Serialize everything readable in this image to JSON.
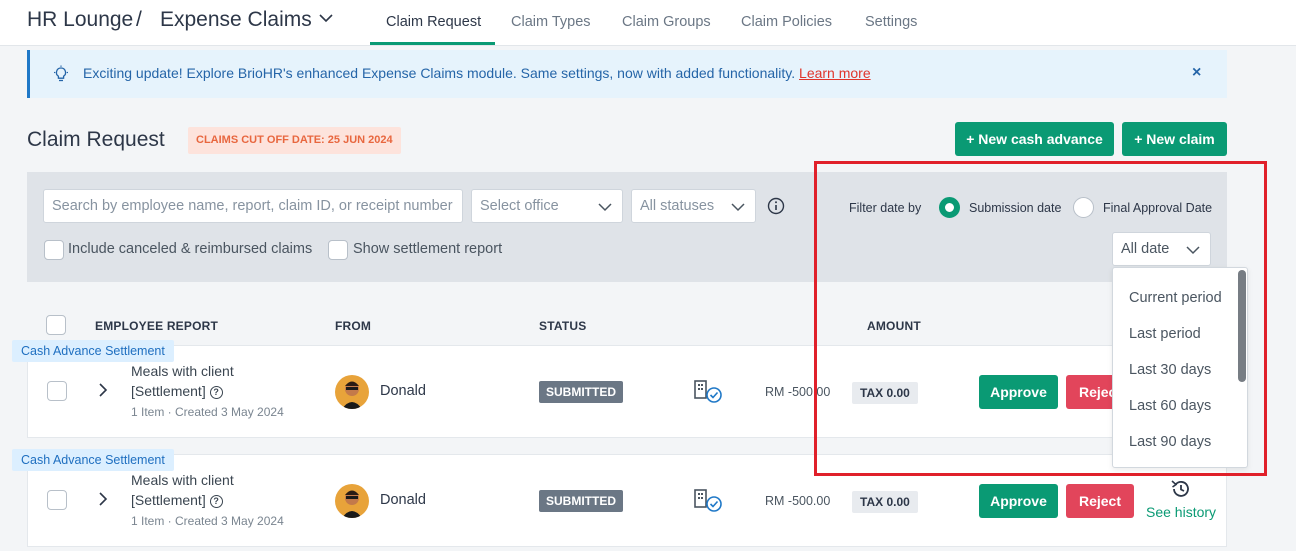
{
  "breadcrumb": {
    "app": "HR Lounge",
    "sep": "/",
    "module": "Expense Claims"
  },
  "tabs": [
    {
      "label": "Claim Request",
      "active": true
    },
    {
      "label": "Claim Types"
    },
    {
      "label": "Claim Groups"
    },
    {
      "label": "Claim Policies"
    },
    {
      "label": "Settings"
    }
  ],
  "banner": {
    "text": "Exciting update! Explore BrioHR's enhanced Expense Claims module. Same settings, now with added functionality.",
    "link": "Learn more",
    "close": "×"
  },
  "page": {
    "title": "Claim Request",
    "cutoff": "CLAIMS CUT OFF DATE: 25 JUN 2024",
    "new_cash_advance": "+ New cash advance",
    "new_claim": "+ New claim"
  },
  "filters": {
    "search_placeholder": "Search by employee name, report, claim ID, or receipt number",
    "office": "Select office",
    "status": "All statuses",
    "include_canceled": "Include canceled & reimbursed claims",
    "show_settlement": "Show settlement report",
    "filter_date_by": "Filter date by",
    "submission_date": "Submission date",
    "final_approval_date": "Final Approval Date",
    "date_range": "All date",
    "date_options": [
      "Current period",
      "Last period",
      "Last 30 days",
      "Last 60 days",
      "Last 90 days"
    ]
  },
  "table": {
    "headers": {
      "employee_report": "EMPLOYEE REPORT",
      "from": "FROM",
      "status": "STATUS",
      "amount": "AMOUNT"
    },
    "rows": [
      {
        "tag": "Cash Advance Settlement",
        "name_line1": "Meals with client",
        "name_line2": "[Settlement]",
        "meta": "1 Item · Created 3 May 2024",
        "from": "Donald",
        "status": "SUBMITTED",
        "amount": "RM -500.00",
        "tax": "TAX 0.00",
        "approve": "Approve",
        "reject": "Reject"
      },
      {
        "tag": "Cash Advance Settlement",
        "name_line1": "Meals with client",
        "name_line2": "[Settlement]",
        "meta": "1 Item · Created 3 May 2024",
        "from": "Donald",
        "status": "SUBMITTED",
        "amount": "RM -500.00",
        "tax": "TAX 0.00",
        "approve": "Approve",
        "reject": "Reject",
        "history": "See history"
      }
    ]
  },
  "colors": {
    "accent": "#0a9a74",
    "reject": "#e2455b",
    "highlight_box": "#e0202a"
  }
}
